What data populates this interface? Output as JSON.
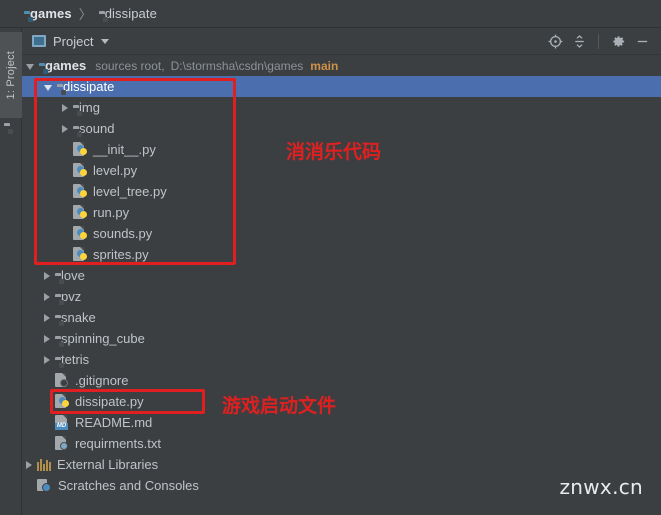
{
  "breadcrumb": {
    "items": [
      {
        "label": "games",
        "icon": "folder-module-icon",
        "bold": true
      },
      {
        "label": "dissipate",
        "icon": "folder-gray-icon",
        "bold": false
      }
    ],
    "separator": "〉"
  },
  "tool_strip": {
    "project_tab_label": "1: Project",
    "folder_icon": "folder-icon"
  },
  "panel_toolbar": {
    "selector_label": "Project",
    "selector_icon": "project-window-icon",
    "actions": [
      {
        "name": "locate-icon",
        "title": "Select Opened File"
      },
      {
        "name": "collapse-all-icon",
        "title": "Collapse All"
      },
      {
        "name": "gear-icon",
        "title": "Settings"
      },
      {
        "name": "minimize-icon",
        "title": "Hide"
      }
    ]
  },
  "tree": {
    "root": {
      "label": "games",
      "sources_root": "sources root,",
      "path": "D:\\stormsha\\csdn\\games",
      "branch": "main",
      "expanded": true
    },
    "nodes": [
      {
        "label": "dissipate",
        "icon": "folder-gray-icon",
        "type": "folder",
        "indent": 1,
        "expanded": true,
        "selected": true
      },
      {
        "label": "img",
        "icon": "folder-gray-icon",
        "type": "folder",
        "indent": 2,
        "expanded": false,
        "selected": false
      },
      {
        "label": "sound",
        "icon": "folder-gray-icon",
        "type": "folder",
        "indent": 2,
        "expanded": false,
        "selected": false
      },
      {
        "label": "__init__.py",
        "icon": "python-file-icon",
        "type": "file",
        "indent": 2,
        "expanded": null,
        "selected": false
      },
      {
        "label": "level.py",
        "icon": "python-file-icon",
        "type": "file",
        "indent": 2,
        "expanded": null,
        "selected": false
      },
      {
        "label": "level_tree.py",
        "icon": "python-file-icon",
        "type": "file",
        "indent": 2,
        "expanded": null,
        "selected": false
      },
      {
        "label": "run.py",
        "icon": "python-file-icon",
        "type": "file",
        "indent": 2,
        "expanded": null,
        "selected": false
      },
      {
        "label": "sounds.py",
        "icon": "python-file-icon",
        "type": "file",
        "indent": 2,
        "expanded": null,
        "selected": false
      },
      {
        "label": "sprites.py",
        "icon": "python-file-icon",
        "type": "file",
        "indent": 2,
        "expanded": null,
        "selected": false
      },
      {
        "label": "love",
        "icon": "folder-gray-icon",
        "type": "folder",
        "indent": 1,
        "expanded": false,
        "selected": false
      },
      {
        "label": "pvz",
        "icon": "folder-gray-icon",
        "type": "folder",
        "indent": 1,
        "expanded": false,
        "selected": false
      },
      {
        "label": "snake",
        "icon": "folder-gray-icon",
        "type": "folder",
        "indent": 1,
        "expanded": false,
        "selected": false
      },
      {
        "label": "spinning_cube",
        "icon": "folder-gray-icon",
        "type": "folder",
        "indent": 1,
        "expanded": false,
        "selected": false
      },
      {
        "label": "tetris",
        "icon": "folder-gray-icon",
        "type": "folder",
        "indent": 1,
        "expanded": false,
        "selected": false
      },
      {
        "label": ".gitignore",
        "icon": "gitignore-file-icon",
        "type": "file",
        "indent": 1,
        "expanded": null,
        "selected": false
      },
      {
        "label": "dissipate.py",
        "icon": "python-file-icon",
        "type": "file",
        "indent": 1,
        "expanded": null,
        "selected": false
      },
      {
        "label": "README.md",
        "icon": "markdown-file-icon",
        "type": "file",
        "indent": 1,
        "expanded": null,
        "selected": false
      },
      {
        "label": "requirments.txt",
        "icon": "text-file-icon",
        "type": "file",
        "indent": 1,
        "expanded": null,
        "selected": false
      },
      {
        "label": "External Libraries",
        "icon": "libraries-icon",
        "type": "node",
        "indent": 0,
        "expanded": false,
        "selected": false
      },
      {
        "label": "Scratches and Consoles",
        "icon": "scratches-icon",
        "type": "node",
        "indent": 0,
        "expanded": null,
        "selected": false
      }
    ]
  },
  "annotations": {
    "color": "#e02020",
    "note_package": "消消乐代码",
    "note_entry": "游戏启动文件"
  },
  "watermark": {
    "text": "znwx.cn"
  }
}
